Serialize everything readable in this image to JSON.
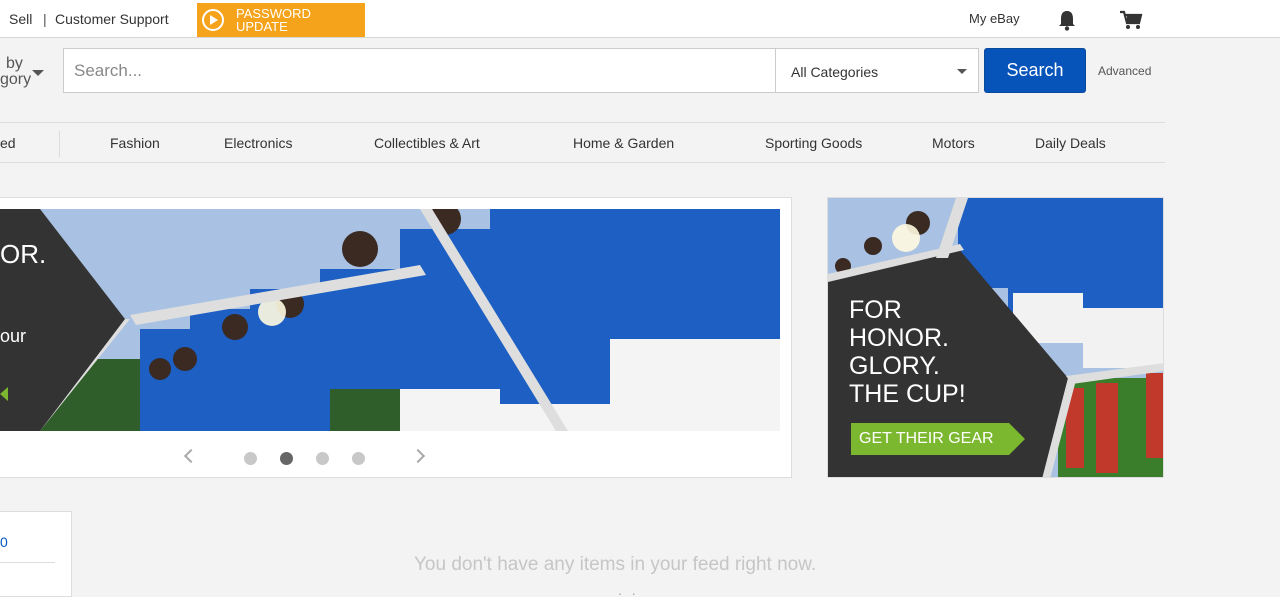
{
  "topbar": {
    "sell": "Sell",
    "separator": "|",
    "support": "Customer Support",
    "password_badge": {
      "line1": "PASSWORD",
      "line2": "UPDATE"
    },
    "my_ebay": "My eBay"
  },
  "search": {
    "shop_by_line1": "by",
    "shop_by_line2": "gory",
    "placeholder": "Search...",
    "category": "All Categories",
    "button": "Search",
    "advanced": "Advanced"
  },
  "nav": {
    "items": [
      "ed",
      "Fashion",
      "Electronics",
      "Collectibles & Art",
      "Home & Garden",
      "Sporting Goods",
      "Motors",
      "Daily Deals"
    ]
  },
  "hero": {
    "text1": "OR.",
    "text2": "our",
    "active_dot": 2,
    "dot_count": 4
  },
  "side_ad": {
    "lines": [
      "FOR",
      "HONOR.",
      "GLORY.",
      "THE CUP!"
    ],
    "cta": "GET THEIR GEAR"
  },
  "feed": {
    "left_card_text": "0",
    "message": "You don't have any items in your feed right now.",
    "trailing": ". ."
  },
  "colors": {
    "accent_blue": "#0654ba",
    "badge_orange": "#f5a31a",
    "cta_green": "#7cb82f"
  }
}
